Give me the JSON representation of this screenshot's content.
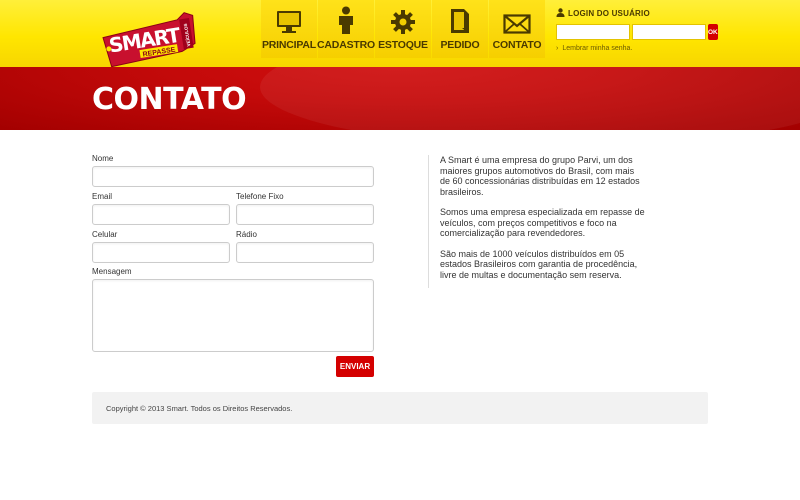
{
  "brand": {
    "logo_main": "SMART",
    "logo_sub": "REPASSE",
    "logo_side": "VEÍCULOS",
    "colors": {
      "yellow": "#ffe600",
      "red": "#d40000",
      "dark": "#4a3a00"
    }
  },
  "nav": {
    "items": [
      {
        "label": "PRINCIPAL",
        "icon": "monitor-icon"
      },
      {
        "label": "CADASTRO",
        "icon": "person-icon"
      },
      {
        "label": "ESTOQUE",
        "icon": "gear-icon"
      },
      {
        "label": "PEDIDO",
        "icon": "document-icon"
      },
      {
        "label": "CONTATO",
        "icon": "envelope-icon"
      }
    ]
  },
  "login": {
    "title": "LOGIN DO USUÁRIO",
    "user_value": "",
    "password_value": "",
    "ok_label": "OK",
    "forgot_label": "Lembrar minha senha."
  },
  "banner": {
    "title": "CONTATO"
  },
  "form": {
    "nome_label": "Nome",
    "email_label": "Email",
    "telefone_label": "Telefone Fixo",
    "celular_label": "Celular",
    "radio_label": "Rádio",
    "mensagem_label": "Mensagem",
    "send_label": "ENVIAR"
  },
  "about": {
    "p1": "A Smart é uma empresa do grupo Parvi, um dos maiores grupos automotivos do Brasil, com mais de 60 concessionárias distribuídas em 12 estados brasileiros.",
    "p2": "Somos uma empresa especializada em repasse de veículos, com preços competitivos e foco na comercialização para revendedores.",
    "p3": "São mais de 1000 veículos distribuídos em 05 estados Brasileiros com garantia de procedência, livre de multas e documentação sem reserva."
  },
  "footer": {
    "copyright": "Copyright © 2013 Smart. Todos os Direitos Reservados."
  }
}
